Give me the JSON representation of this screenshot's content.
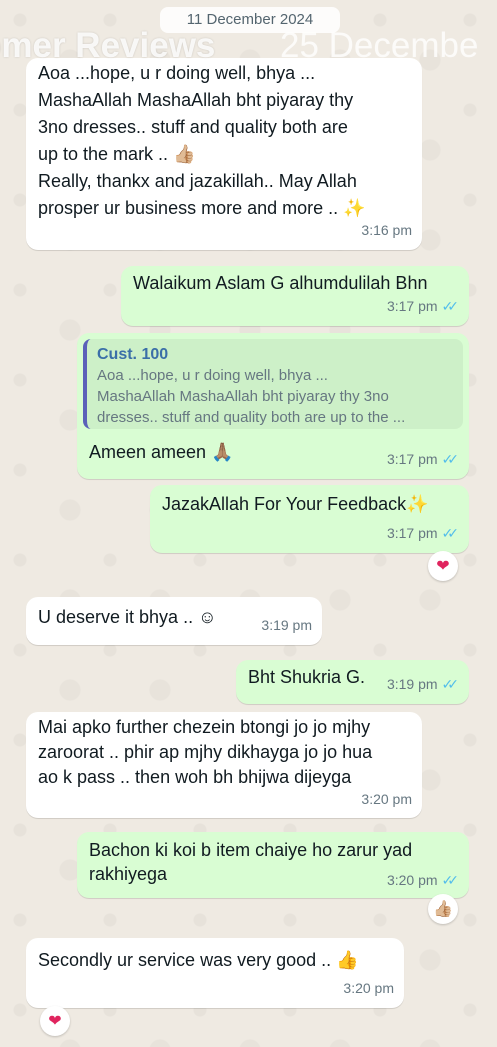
{
  "date_chip": "11 December 2024",
  "watermark": {
    "left": "omer Reviews",
    "right": "25 Decembe"
  },
  "messages": [
    {
      "lines": [
        "Aoa ...hope, u r doing well, bhya ...",
        "MashaAllah MashaAllah bht piyaray thy",
        "3no dresses.. stuff and quality both are",
        "up to the mark .. 👍🏼",
        "Really, thankx and jazakillah.. May Allah",
        "prosper ur business more and more .. ✨"
      ],
      "time": "3:16 pm"
    },
    {
      "text": "Walaikum Aslam G alhumdulilah Bhn",
      "time": "3:17 pm"
    },
    {
      "quote_name": "Cust. 100",
      "quote_lines": [
        "Aoa ...hope, u r doing well, bhya ...",
        "MashaAllah MashaAllah bht piyaray thy 3no",
        "dresses.. stuff and quality both are up to the ..."
      ],
      "text": "Ameen ameen 🙏🏽",
      "time": "3:17 pm"
    },
    {
      "text": "JazakAllah For Your Feedback✨",
      "time": "3:17 pm",
      "reaction": "❤"
    },
    {
      "text": "U deserve it bhya .. ☺",
      "time": "3:19 pm"
    },
    {
      "text": "Bht Shukria G.",
      "time": "3:19 pm"
    },
    {
      "lines": [
        "Mai apko further chezein btongi jo jo mjhy",
        "zaroorat .. phir ap mjhy dikhayga jo jo hua",
        "ao k pass .. then woh bh bhijwa dijeyga"
      ],
      "time": "3:20 pm"
    },
    {
      "lines": [
        "Bachon ki koi b item chaiye ho zarur yad",
        "rakhiyega"
      ],
      "time": "3:20 pm",
      "reaction": "👍🏼"
    },
    {
      "text": "Secondly ur service was very good .. 👍",
      "time": "3:20 pm",
      "reaction": "❤"
    }
  ],
  "ticks": "✓✓"
}
